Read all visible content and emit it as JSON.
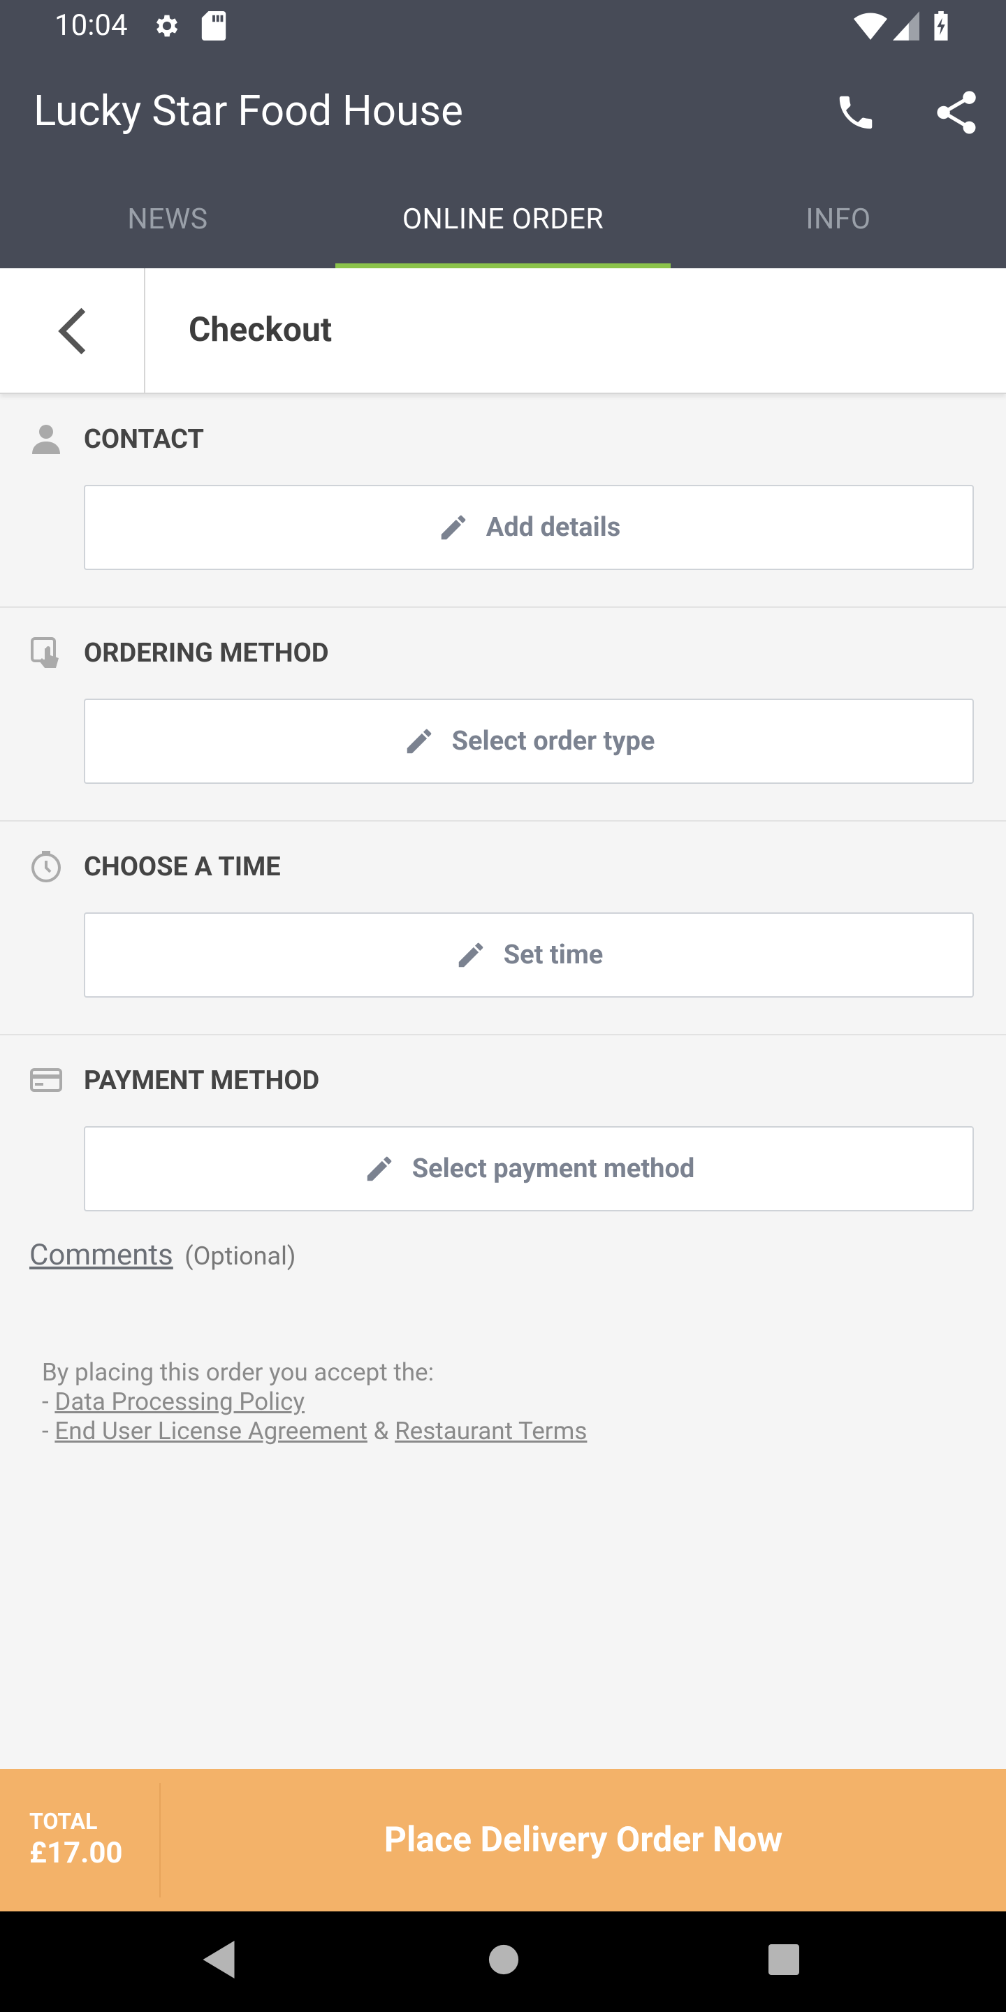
{
  "status_bar": {
    "time": "10:04"
  },
  "app_bar": {
    "title": "Lucky Star Food House"
  },
  "tabs": [
    {
      "label": "NEWS",
      "active": false
    },
    {
      "label": "ONLINE ORDER",
      "active": true
    },
    {
      "label": "INFO",
      "active": false
    }
  ],
  "checkout": {
    "title": "Checkout"
  },
  "sections": [
    {
      "title": "CONTACT",
      "button": "Add details",
      "icon": "person-icon"
    },
    {
      "title": "ORDERING METHOD",
      "button": "Select order type",
      "icon": "tap-icon"
    },
    {
      "title": "CHOOSE A TIME",
      "button": "Set time",
      "icon": "clock-icon"
    },
    {
      "title": "PAYMENT METHOD",
      "button": "Select payment method",
      "icon": "card-icon"
    }
  ],
  "comments": {
    "label": "Comments",
    "optional": "(Optional)"
  },
  "terms": {
    "intro": "By placing this order you accept the:",
    "dash": "- ",
    "data_policy": "Data Processing Policy",
    "eula": "End User License Agreement",
    "amp": " & ",
    "restaurant_terms": "Restaurant Terms"
  },
  "order_bar": {
    "total_label": "TOTAL",
    "total_value": "£17.00",
    "place_label": "Place Delivery Order Now"
  },
  "colors": {
    "header": "#474b57",
    "tab_indicator": "#8bc34a",
    "order_bar": "#f3b269"
  }
}
